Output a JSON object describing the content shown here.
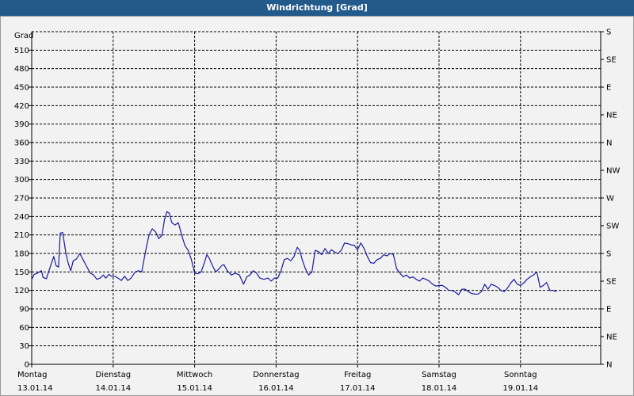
{
  "window": {
    "title": "Windrichtung [Grad]"
  },
  "colors": {
    "titlebar": "#235a8c",
    "line": "#1a1aa0",
    "grid": "#000000",
    "background": "#f2f2f2"
  },
  "chart_data": {
    "type": "line",
    "title": "Windrichtung [Grad]",
    "ylabel": "Grad",
    "ylim": [
      0,
      540
    ],
    "yticks": [
      0,
      30,
      60,
      90,
      120,
      150,
      180,
      210,
      240,
      270,
      300,
      330,
      360,
      390,
      420,
      450,
      480,
      510
    ],
    "right_axis_labels": [
      {
        "value": 0,
        "label": "N"
      },
      {
        "value": 45,
        "label": "NE"
      },
      {
        "value": 90,
        "label": "E"
      },
      {
        "value": 135,
        "label": "SE"
      },
      {
        "value": 180,
        "label": "S"
      },
      {
        "value": 225,
        "label": "SW"
      },
      {
        "value": 270,
        "label": "W"
      },
      {
        "value": 315,
        "label": "NW"
      },
      {
        "value": 360,
        "label": "N"
      },
      {
        "value": 405,
        "label": "NE"
      },
      {
        "value": 450,
        "label": "E"
      },
      {
        "value": 495,
        "label": "SE"
      },
      {
        "value": 540,
        "label": "S"
      }
    ],
    "xlim": [
      0,
      7
    ],
    "days": [
      {
        "x": 0,
        "name": "Montag",
        "date": "13.01.14"
      },
      {
        "x": 1,
        "name": "Dienstag",
        "date": "14.01.14"
      },
      {
        "x": 2,
        "name": "Mittwoch",
        "date": "15.01.14"
      },
      {
        "x": 3,
        "name": "Donnerstag",
        "date": "16.01.14"
      },
      {
        "x": 4,
        "name": "Freitag",
        "date": "17.01.14"
      },
      {
        "x": 5,
        "name": "Samstag",
        "date": "18.01.14"
      },
      {
        "x": 6,
        "name": "Sonntag",
        "date": "19.01.14"
      }
    ],
    "grid": true,
    "series": [
      {
        "points": [
          [
            0.0,
            138
          ],
          [
            0.03,
            146
          ],
          [
            0.07,
            148
          ],
          [
            0.12,
            152
          ],
          [
            0.14,
            141
          ],
          [
            0.18,
            139
          ],
          [
            0.22,
            155
          ],
          [
            0.27,
            175
          ],
          [
            0.3,
            160
          ],
          [
            0.33,
            158
          ],
          [
            0.35,
            213
          ],
          [
            0.38,
            214
          ],
          [
            0.42,
            180
          ],
          [
            0.45,
            163
          ],
          [
            0.48,
            152
          ],
          [
            0.51,
            168
          ],
          [
            0.55,
            171
          ],
          [
            0.59,
            180
          ],
          [
            0.63,
            170
          ],
          [
            0.67,
            160
          ],
          [
            0.72,
            148
          ],
          [
            0.76,
            145
          ],
          [
            0.8,
            138
          ],
          [
            0.84,
            140
          ],
          [
            0.88,
            145
          ],
          [
            0.91,
            140
          ],
          [
            0.95,
            146
          ],
          [
            0.98,
            143
          ],
          [
            1.02,
            143
          ],
          [
            1.06,
            140
          ],
          [
            1.1,
            136
          ],
          [
            1.14,
            143
          ],
          [
            1.18,
            136
          ],
          [
            1.22,
            140
          ],
          [
            1.27,
            150
          ],
          [
            1.31,
            152
          ],
          [
            1.35,
            150
          ],
          [
            1.4,
            185
          ],
          [
            1.44,
            210
          ],
          [
            1.48,
            220
          ],
          [
            1.52,
            215
          ],
          [
            1.56,
            204
          ],
          [
            1.6,
            210
          ],
          [
            1.63,
            235
          ],
          [
            1.66,
            248
          ],
          [
            1.69,
            245
          ],
          [
            1.72,
            230
          ],
          [
            1.76,
            226
          ],
          [
            1.8,
            230
          ],
          [
            1.84,
            210
          ],
          [
            1.88,
            193
          ],
          [
            1.92,
            185
          ],
          [
            1.96,
            170
          ],
          [
            2.0,
            148
          ],
          [
            2.04,
            147
          ],
          [
            2.08,
            150
          ],
          [
            2.12,
            165
          ],
          [
            2.15,
            178
          ],
          [
            2.18,
            172
          ],
          [
            2.22,
            160
          ],
          [
            2.26,
            150
          ],
          [
            2.3,
            155
          ],
          [
            2.33,
            160
          ],
          [
            2.36,
            162
          ],
          [
            2.4,
            152
          ],
          [
            2.45,
            145
          ],
          [
            2.5,
            148
          ],
          [
            2.55,
            145
          ],
          [
            2.6,
            130
          ],
          [
            2.64,
            142
          ],
          [
            2.68,
            145
          ],
          [
            2.72,
            152
          ],
          [
            2.76,
            148
          ],
          [
            2.8,
            140
          ],
          [
            2.85,
            138
          ],
          [
            2.9,
            140
          ],
          [
            2.94,
            135
          ],
          [
            2.98,
            140
          ],
          [
            3.02,
            140
          ],
          [
            3.06,
            152
          ],
          [
            3.1,
            170
          ],
          [
            3.14,
            172
          ],
          [
            3.18,
            168
          ],
          [
            3.22,
            175
          ],
          [
            3.26,
            190
          ],
          [
            3.29,
            185
          ],
          [
            3.32,
            170
          ],
          [
            3.36,
            155
          ],
          [
            3.4,
            145
          ],
          [
            3.44,
            150
          ],
          [
            3.48,
            185
          ],
          [
            3.52,
            183
          ],
          [
            3.56,
            178
          ],
          [
            3.6,
            188
          ],
          [
            3.64,
            180
          ],
          [
            3.68,
            186
          ],
          [
            3.72,
            182
          ],
          [
            3.76,
            180
          ],
          [
            3.8,
            185
          ],
          [
            3.84,
            197
          ],
          [
            3.88,
            196
          ],
          [
            3.92,
            194
          ],
          [
            3.96,
            193
          ],
          [
            4.0,
            186
          ],
          [
            4.04,
            197
          ],
          [
            4.08,
            188
          ],
          [
            4.12,
            175
          ],
          [
            4.16,
            165
          ],
          [
            4.2,
            164
          ],
          [
            4.24,
            170
          ],
          [
            4.28,
            172
          ],
          [
            4.32,
            178
          ],
          [
            4.36,
            176
          ],
          [
            4.4,
            180
          ],
          [
            4.44,
            178
          ],
          [
            4.48,
            155
          ],
          [
            4.52,
            148
          ],
          [
            4.56,
            142
          ],
          [
            4.6,
            145
          ],
          [
            4.64,
            140
          ],
          [
            4.68,
            142
          ],
          [
            4.72,
            138
          ],
          [
            4.76,
            135
          ],
          [
            4.8,
            140
          ],
          [
            4.84,
            138
          ],
          [
            4.88,
            135
          ],
          [
            4.92,
            130
          ],
          [
            4.96,
            127
          ],
          [
            5.0,
            128
          ],
          [
            5.04,
            128
          ],
          [
            5.08,
            125
          ],
          [
            5.12,
            120
          ],
          [
            5.16,
            120
          ],
          [
            5.2,
            117
          ],
          [
            5.24,
            113
          ],
          [
            5.28,
            122
          ],
          [
            5.32,
            122
          ],
          [
            5.36,
            118
          ],
          [
            5.4,
            115
          ],
          [
            5.44,
            114
          ],
          [
            5.48,
            114
          ],
          [
            5.52,
            118
          ],
          [
            5.56,
            130
          ],
          [
            5.6,
            122
          ],
          [
            5.64,
            130
          ],
          [
            5.68,
            128
          ],
          [
            5.72,
            125
          ],
          [
            5.76,
            120
          ],
          [
            5.8,
            118
          ],
          [
            5.84,
            124
          ],
          [
            5.88,
            132
          ],
          [
            5.92,
            138
          ],
          [
            5.96,
            130
          ],
          [
            6.0,
            128
          ],
          [
            6.04,
            132
          ],
          [
            6.08,
            138
          ],
          [
            6.12,
            142
          ],
          [
            6.16,
            145
          ],
          [
            6.2,
            150
          ],
          [
            6.24,
            125
          ],
          [
            6.28,
            128
          ],
          [
            6.32,
            133
          ],
          [
            6.36,
            120
          ],
          [
            6.4,
            120
          ],
          [
            6.44,
            118
          ]
        ]
      }
    ]
  }
}
